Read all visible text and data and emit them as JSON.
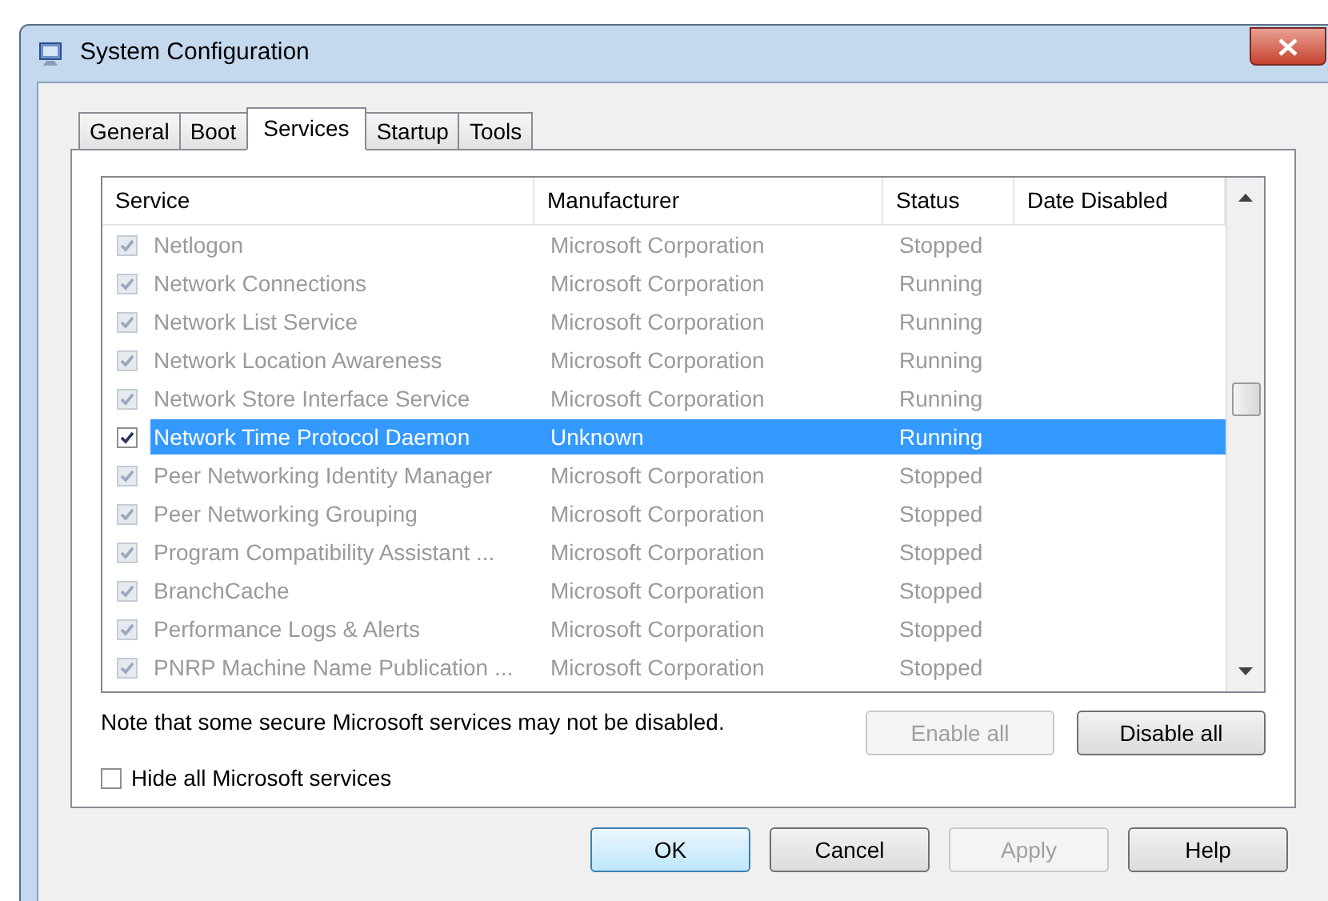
{
  "window": {
    "title": "System Configuration"
  },
  "tabs": [
    {
      "label": "General",
      "selected": false
    },
    {
      "label": "Boot",
      "selected": false
    },
    {
      "label": "Services",
      "selected": true
    },
    {
      "label": "Startup",
      "selected": false
    },
    {
      "label": "Tools",
      "selected": false
    }
  ],
  "table": {
    "columns": [
      "Service",
      "Manufacturer",
      "Status",
      "Date Disabled"
    ],
    "rows": [
      {
        "service": "Netlogon",
        "manufacturer": "Microsoft Corporation",
        "status": "Stopped",
        "checked": true,
        "disabled": true,
        "selected": false
      },
      {
        "service": "Network Connections",
        "manufacturer": "Microsoft Corporation",
        "status": "Running",
        "checked": true,
        "disabled": true,
        "selected": false
      },
      {
        "service": "Network List Service",
        "manufacturer": "Microsoft Corporation",
        "status": "Running",
        "checked": true,
        "disabled": true,
        "selected": false
      },
      {
        "service": "Network Location Awareness",
        "manufacturer": "Microsoft Corporation",
        "status": "Running",
        "checked": true,
        "disabled": true,
        "selected": false
      },
      {
        "service": "Network Store Interface Service",
        "manufacturer": "Microsoft Corporation",
        "status": "Running",
        "checked": true,
        "disabled": true,
        "selected": false
      },
      {
        "service": "Network Time Protocol Daemon",
        "manufacturer": "Unknown",
        "status": "Running",
        "checked": true,
        "disabled": false,
        "selected": true
      },
      {
        "service": "Peer Networking Identity Manager",
        "manufacturer": "Microsoft Corporation",
        "status": "Stopped",
        "checked": true,
        "disabled": true,
        "selected": false
      },
      {
        "service": "Peer Networking Grouping",
        "manufacturer": "Microsoft Corporation",
        "status": "Stopped",
        "checked": true,
        "disabled": true,
        "selected": false
      },
      {
        "service": "Program Compatibility Assistant ...",
        "manufacturer": "Microsoft Corporation",
        "status": "Stopped",
        "checked": true,
        "disabled": true,
        "selected": false
      },
      {
        "service": "BranchCache",
        "manufacturer": "Microsoft Corporation",
        "status": "Stopped",
        "checked": true,
        "disabled": true,
        "selected": false
      },
      {
        "service": "Performance Logs & Alerts",
        "manufacturer": "Microsoft Corporation",
        "status": "Stopped",
        "checked": true,
        "disabled": true,
        "selected": false
      },
      {
        "service": "PNRP Machine Name Publication ...",
        "manufacturer": "Microsoft Corporation",
        "status": "Stopped",
        "checked": true,
        "disabled": true,
        "selected": false
      }
    ]
  },
  "note": "Note that some secure Microsoft services may not be disabled.",
  "list_buttons": [
    {
      "label": "Enable all",
      "disabled": true
    },
    {
      "label": "Disable all",
      "disabled": false
    }
  ],
  "hide_microsoft": {
    "label": "Hide all Microsoft services",
    "checked": false
  },
  "buttons": [
    {
      "label": "OK",
      "disabled": false,
      "default": true
    },
    {
      "label": "Cancel",
      "disabled": false,
      "default": false
    },
    {
      "label": "Apply",
      "disabled": true,
      "default": false
    },
    {
      "label": "Help",
      "disabled": false,
      "default": false
    }
  ]
}
